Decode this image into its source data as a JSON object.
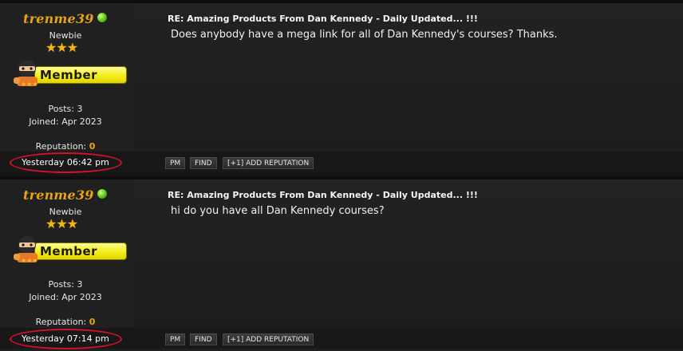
{
  "posts": [
    {
      "username": "trenme39",
      "usertitle": "Newbie",
      "stars": "★★★",
      "badge_text": "Member",
      "posts_label": "Posts:",
      "posts_value": "3",
      "joined_label": "Joined:",
      "joined_value": "Apr 2023",
      "reputation_label": "Reputation:",
      "reputation_value": "0",
      "title": "RE: Amazing Products From Dan Kennedy - Daily Updated... !!!",
      "body": "Does anybody have a mega link for all of Dan Kennedy's courses? Thanks.",
      "timestamp": "Yesterday 06:42 pm",
      "buttons": {
        "pm": "PM",
        "find": "FIND",
        "rep": "[+1] ADD REPUTATION"
      }
    },
    {
      "username": "trenme39",
      "usertitle": "Newbie",
      "stars": "★★★",
      "badge_text": "Member",
      "posts_label": "Posts:",
      "posts_value": "3",
      "joined_label": "Joined:",
      "joined_value": "Apr 2023",
      "reputation_label": "Reputation:",
      "reputation_value": "0",
      "title": "RE: Amazing Products From Dan Kennedy - Daily Updated... !!!",
      "body": "hi do you have all Dan Kennedy courses?",
      "timestamp": "Yesterday 07:14 pm",
      "buttons": {
        "pm": "PM",
        "find": "FIND",
        "rep": "[+1] ADD REPUTATION"
      }
    }
  ],
  "colors": {
    "username": "#e8a317",
    "online": "#56c21b",
    "highlight_ellipse": "#d6102b",
    "badge": "#f5ef20"
  },
  "icons": {
    "online": "online-status-icon",
    "rank": "ninja-rank-icon"
  }
}
